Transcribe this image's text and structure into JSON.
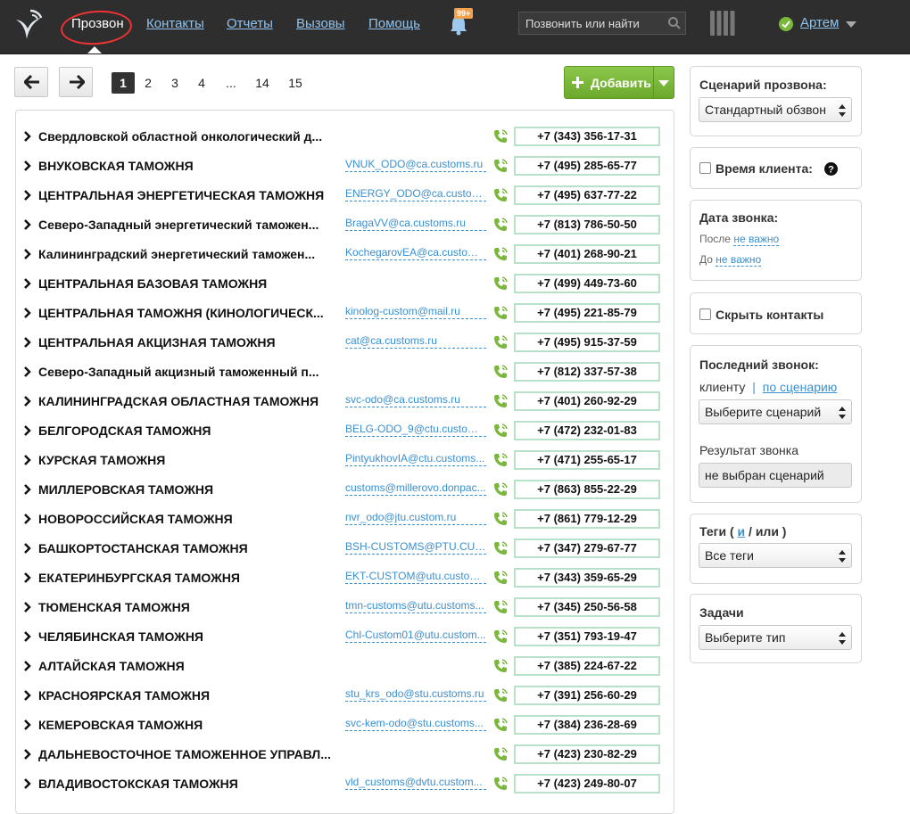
{
  "nav": {
    "items": [
      {
        "label": "Прозвон",
        "active": true
      },
      {
        "label": "Контакты"
      },
      {
        "label": "Отчеты"
      },
      {
        "label": "Вызовы"
      },
      {
        "label": "Помощь"
      }
    ],
    "notification_badge": "99+",
    "search_placeholder": "Позвонить или найти",
    "user_name": "Артем"
  },
  "toolbar": {
    "pages": [
      "1",
      "2",
      "3",
      "4",
      "...",
      "14",
      "15"
    ],
    "current_page": "1",
    "add_label": "Добавить"
  },
  "contacts": [
    {
      "name": "Свердловской областной онкологический д...",
      "email": "",
      "phone": "+7 (343) 356-17-31"
    },
    {
      "name": "ВНУКОВСКАЯ ТАМОЖНЯ",
      "email": "VNUK_ODO@ca.customs.ru",
      "phone": "+7 (495) 285-65-77"
    },
    {
      "name": "ЦЕНТРАЛЬНАЯ ЭНЕРГЕТИЧЕСКАЯ ТАМОЖНЯ",
      "email": "ENERGY_ODO@ca.customs...",
      "phone": "+7 (495) 637-77-22"
    },
    {
      "name": "Северо-Западный энергетический таможен...",
      "email": "BragaVV@ca.customs.ru",
      "phone": "+7 (813) 786-50-50"
    },
    {
      "name": "Калининградский энергетический таможен...",
      "email": "KochegarovEA@ca.customs...",
      "phone": "+7 (401) 268-90-21"
    },
    {
      "name": "ЦЕНТРАЛЬНАЯ БАЗОВАЯ ТАМОЖНЯ",
      "email": "",
      "phone": "+7 (499) 449-73-60"
    },
    {
      "name": "ЦЕНТРАЛЬНАЯ ТАМОЖНЯ (КИНОЛОГИЧЕСК...",
      "email": "kinolog-custom@mail.ru",
      "phone": "+7 (495) 221-85-79"
    },
    {
      "name": "ЦЕНТРАЛЬНАЯ АКЦИЗНАЯ ТАМОЖНЯ",
      "email": "cat@ca.customs.ru",
      "phone": "+7 (495) 915-37-59"
    },
    {
      "name": "Северо-Западный акцизный таможенный п...",
      "email": "",
      "phone": "+7 (812) 337-57-38"
    },
    {
      "name": "КАЛИНИНГРАДСКАЯ ОБЛАСТНАЯ ТАМОЖНЯ",
      "email": "svc-odo@ca.customs.ru",
      "phone": "+7 (401) 260-92-29"
    },
    {
      "name": "БЕЛГОРОДСКАЯ ТАМОЖНЯ",
      "email": "BELG-ODO_9@ctu.customs...",
      "phone": "+7 (472) 232-01-83"
    },
    {
      "name": "КУРСКАЯ ТАМОЖНЯ",
      "email": "PintyukhovIA@ctu.customs...",
      "phone": "+7 (471) 255-65-17"
    },
    {
      "name": "МИЛЛЕРОВСКАЯ ТАМОЖНЯ",
      "email": "customs@millerovo.donpac...",
      "phone": "+7 (863) 855-22-29"
    },
    {
      "name": "НОВОРОССИЙСКАЯ ТАМОЖНЯ",
      "email": "nvr_odo@jtu.custom.ru",
      "phone": "+7 (861) 779-12-29"
    },
    {
      "name": "БАШКОРТОСТАНСКАЯ ТАМОЖНЯ",
      "email": "BSH-CUSTOMS@PTU.CUST...",
      "phone": "+7 (347) 279-67-77"
    },
    {
      "name": "ЕКАТЕРИНБУРГСКАЯ ТАМОЖНЯ",
      "email": "EKT-CUSTOM@utu.custom...",
      "phone": "+7 (343) 359-65-29"
    },
    {
      "name": "ТЮМЕНСКАЯ ТАМОЖНЯ",
      "email": "tmn-customs@utu.customs...",
      "phone": "+7 (345) 250-56-58"
    },
    {
      "name": "ЧЕЛЯБИНСКАЯ ТАМОЖНЯ",
      "email": "Chl-Custom01@utu.custom...",
      "phone": "+7 (351) 793-19-47"
    },
    {
      "name": "АЛТАЙСКАЯ ТАМОЖНЯ",
      "email": "",
      "phone": "+7 (385) 224-67-22"
    },
    {
      "name": "КРАСНОЯРСКАЯ ТАМОЖНЯ",
      "email": "stu_krs_odo@stu.customs.ru",
      "phone": "+7 (391) 256-60-29"
    },
    {
      "name": "КЕМЕРОВСКАЯ ТАМОЖНЯ",
      "email": "svc-kem-odo@stu.customs...",
      "phone": "+7 (384) 236-28-69"
    },
    {
      "name": "ДАЛЬНЕВОСТОЧНОЕ ТАМОЖЕННОЕ УПРАВЛ...",
      "email": "",
      "phone": "+7 (423) 230-82-29"
    },
    {
      "name": "ВЛАДИВОСТОКСКАЯ ТАМОЖНЯ",
      "email": "vld_customs@dvtu.custom...",
      "phone": "+7 (423) 249-80-07"
    }
  ],
  "sidebar": {
    "scenario": {
      "title": "Сценарий прозвона:",
      "selected": "Стандартный обзвон"
    },
    "client_time": {
      "label": "Время клиента:",
      "help_icon": "question-circle-icon"
    },
    "call_date": {
      "title": "Дата звонка:",
      "after_label": "После",
      "after_value": "не важно",
      "before_label": "До",
      "before_value": "не важно"
    },
    "hide_contacts": {
      "label": "Скрыть контакты"
    },
    "last_call": {
      "title": "Последний звонок:",
      "by_client": "клиенту",
      "separator": "|",
      "by_scenario": "по сценарию",
      "scenario_select": "Выберите сценарий",
      "result_label": "Результат звонка",
      "result_value": "не выбран сценарий"
    },
    "tags": {
      "title_prefix": "Теги (",
      "and": "и",
      "slash": "/",
      "or": "или )",
      "selected": "Все теги"
    },
    "tasks": {
      "title": "Задачи",
      "selected": "Выберите тип"
    }
  },
  "colors": {
    "topbar": "#2e2e2e",
    "accent_green": "#7ab83b",
    "link_blue": "#3b8fd0",
    "phone_border": "#b9e0c9",
    "badge_orange": "#f4a24a"
  }
}
